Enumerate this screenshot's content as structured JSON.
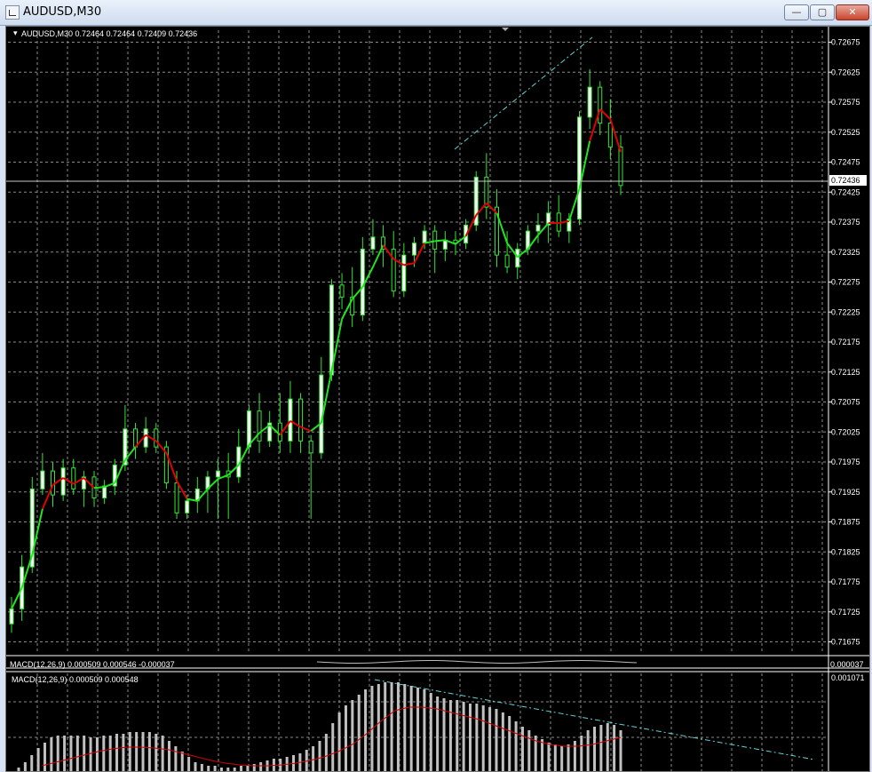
{
  "window": {
    "title": "AUDUSD,M30",
    "minimize_glyph": "—",
    "maximize_glyph": "▢",
    "close_glyph": "✕"
  },
  "main_chart": {
    "header": "AUDUSD,M30  0.72464 0.72464 0.72409 0.72436",
    "price_labels": [
      "0.72675",
      "0.72625",
      "0.72575",
      "0.72525",
      "0.72475",
      "0.72425",
      "0.72375",
      "0.72325",
      "0.72275",
      "0.72225",
      "0.72175",
      "0.72125",
      "0.72075",
      "0.72025",
      "0.71975",
      "0.71925",
      "0.71875",
      "0.71825",
      "0.71775",
      "0.71725",
      "0.71675"
    ],
    "current_price": "0.72436"
  },
  "indicator_strip": {
    "label": "MACD(12,26,9) 0.000509 0.000546 -0.000037",
    "axis_value": "0.000037"
  },
  "macd_panel": {
    "label": "MACD(12,26,9) 0.000509 0.000548",
    "axis_value": "0.001071"
  },
  "colors": {
    "background": "#000000",
    "grid": "#8a8a8a",
    "candle_up": "#ffffff",
    "candle_down": "#ffffff",
    "ma_up": "#22e322",
    "ma_down": "#e30000",
    "trendline": "#5fd3d3",
    "macd_hist": "#c0c0c0",
    "macd_signal": "#d10000"
  },
  "chart_data": {
    "type": "candlestick",
    "symbol": "AUDUSD",
    "timeframe": "M30",
    "ylim": [
      0.71655,
      0.72695
    ],
    "candles": [
      [
        0.71705,
        0.7175,
        0.7169,
        0.7173
      ],
      [
        0.7173,
        0.7182,
        0.7171,
        0.718
      ],
      [
        0.718,
        0.7195,
        0.7179,
        0.7193
      ],
      [
        0.7193,
        0.7199,
        0.7192,
        0.7196
      ],
      [
        0.7196,
        0.71975,
        0.719,
        0.7192
      ],
      [
        0.7192,
        0.7198,
        0.7191,
        0.71965
      ],
      [
        0.71965,
        0.7198,
        0.7192,
        0.7193
      ],
      [
        0.7193,
        0.7196,
        0.719,
        0.7195
      ],
      [
        0.7195,
        0.7196,
        0.719,
        0.71915
      ],
      [
        0.71915,
        0.71945,
        0.71905,
        0.71935
      ],
      [
        0.71935,
        0.7198,
        0.7192,
        0.7197
      ],
      [
        0.7197,
        0.7207,
        0.7196,
        0.7203
      ],
      [
        0.7203,
        0.7204,
        0.7198,
        0.72
      ],
      [
        0.72,
        0.7205,
        0.7199,
        0.7203
      ],
      [
        0.7203,
        0.7204,
        0.7199,
        0.72
      ],
      [
        0.72,
        0.7201,
        0.7193,
        0.7194
      ],
      [
        0.7194,
        0.7196,
        0.7188,
        0.7189
      ],
      [
        0.7189,
        0.7192,
        0.7188,
        0.7191
      ],
      [
        0.7191,
        0.7195,
        0.7189,
        0.7193
      ],
      [
        0.7193,
        0.7196,
        0.7189,
        0.7195
      ],
      [
        0.7195,
        0.7198,
        0.7188,
        0.7196
      ],
      [
        0.7196,
        0.7199,
        0.7188,
        0.7195
      ],
      [
        0.7195,
        0.7203,
        0.7194,
        0.72
      ],
      [
        0.72,
        0.7207,
        0.7199,
        0.7206
      ],
      [
        0.7206,
        0.7209,
        0.7199,
        0.7201
      ],
      [
        0.7201,
        0.7206,
        0.72,
        0.7204
      ],
      [
        0.7204,
        0.7209,
        0.7199,
        0.7201
      ],
      [
        0.7201,
        0.7211,
        0.7199,
        0.7208
      ],
      [
        0.7208,
        0.7209,
        0.7199,
        0.7201
      ],
      [
        0.7201,
        0.7202,
        0.7188,
        0.7199
      ],
      [
        0.7199,
        0.7215,
        0.7198,
        0.7212
      ],
      [
        0.7212,
        0.7228,
        0.7211,
        0.7227
      ],
      [
        0.7227,
        0.7229,
        0.7223,
        0.7225
      ],
      [
        0.7225,
        0.723,
        0.722,
        0.7222
      ],
      [
        0.7222,
        0.7235,
        0.7221,
        0.7233
      ],
      [
        0.7233,
        0.7238,
        0.7232,
        0.7235
      ],
      [
        0.7235,
        0.7237,
        0.723,
        0.7233
      ],
      [
        0.7233,
        0.7236,
        0.7225,
        0.7226
      ],
      [
        0.7226,
        0.7234,
        0.7225,
        0.7232
      ],
      [
        0.7232,
        0.7235,
        0.723,
        0.7234
      ],
      [
        0.7234,
        0.7237,
        0.7233,
        0.7236
      ],
      [
        0.7236,
        0.7237,
        0.7229,
        0.7233
      ],
      [
        0.7233,
        0.7236,
        0.7231,
        0.72345
      ],
      [
        0.72345,
        0.7236,
        0.7232,
        0.7234
      ],
      [
        0.7234,
        0.7238,
        0.7233,
        0.7237
      ],
      [
        0.7237,
        0.7246,
        0.7236,
        0.7245
      ],
      [
        0.7245,
        0.7249,
        0.7238,
        0.724
      ],
      [
        0.724,
        0.7243,
        0.723,
        0.7232
      ],
      [
        0.7232,
        0.7236,
        0.7229,
        0.723
      ],
      [
        0.723,
        0.7234,
        0.7228,
        0.7233
      ],
      [
        0.7233,
        0.7237,
        0.7232,
        0.7236
      ],
      [
        0.7236,
        0.7239,
        0.7234,
        0.7237
      ],
      [
        0.7237,
        0.7241,
        0.7234,
        0.7239
      ],
      [
        0.7239,
        0.7242,
        0.7235,
        0.7236
      ],
      [
        0.7236,
        0.7239,
        0.7234,
        0.7238
      ],
      [
        0.7238,
        0.7256,
        0.7237,
        0.7255
      ],
      [
        0.7255,
        0.7263,
        0.7253,
        0.726
      ],
      [
        0.726,
        0.7261,
        0.7252,
        0.7254
      ],
      [
        0.7254,
        0.7258,
        0.7248,
        0.725
      ],
      [
        0.725,
        0.7252,
        0.7242,
        0.72436
      ]
    ],
    "ma_trend": [
      "up",
      "up",
      "up",
      "up",
      "down",
      "down",
      "down",
      "down",
      "down",
      "up",
      "up",
      "up",
      "up",
      "down",
      "down",
      "down",
      "down",
      "down",
      "up",
      "up",
      "up",
      "up",
      "up",
      "up",
      "up",
      "up",
      "up",
      "down",
      "down",
      "down",
      "up",
      "up",
      "up",
      "up",
      "up",
      "up",
      "up",
      "down",
      "down",
      "down",
      "down",
      "up",
      "up",
      "up",
      "up",
      "down",
      "down",
      "down",
      "up",
      "up",
      "up",
      "up",
      "up",
      "down",
      "down",
      "up",
      "up",
      "down",
      "down",
      "down"
    ]
  }
}
